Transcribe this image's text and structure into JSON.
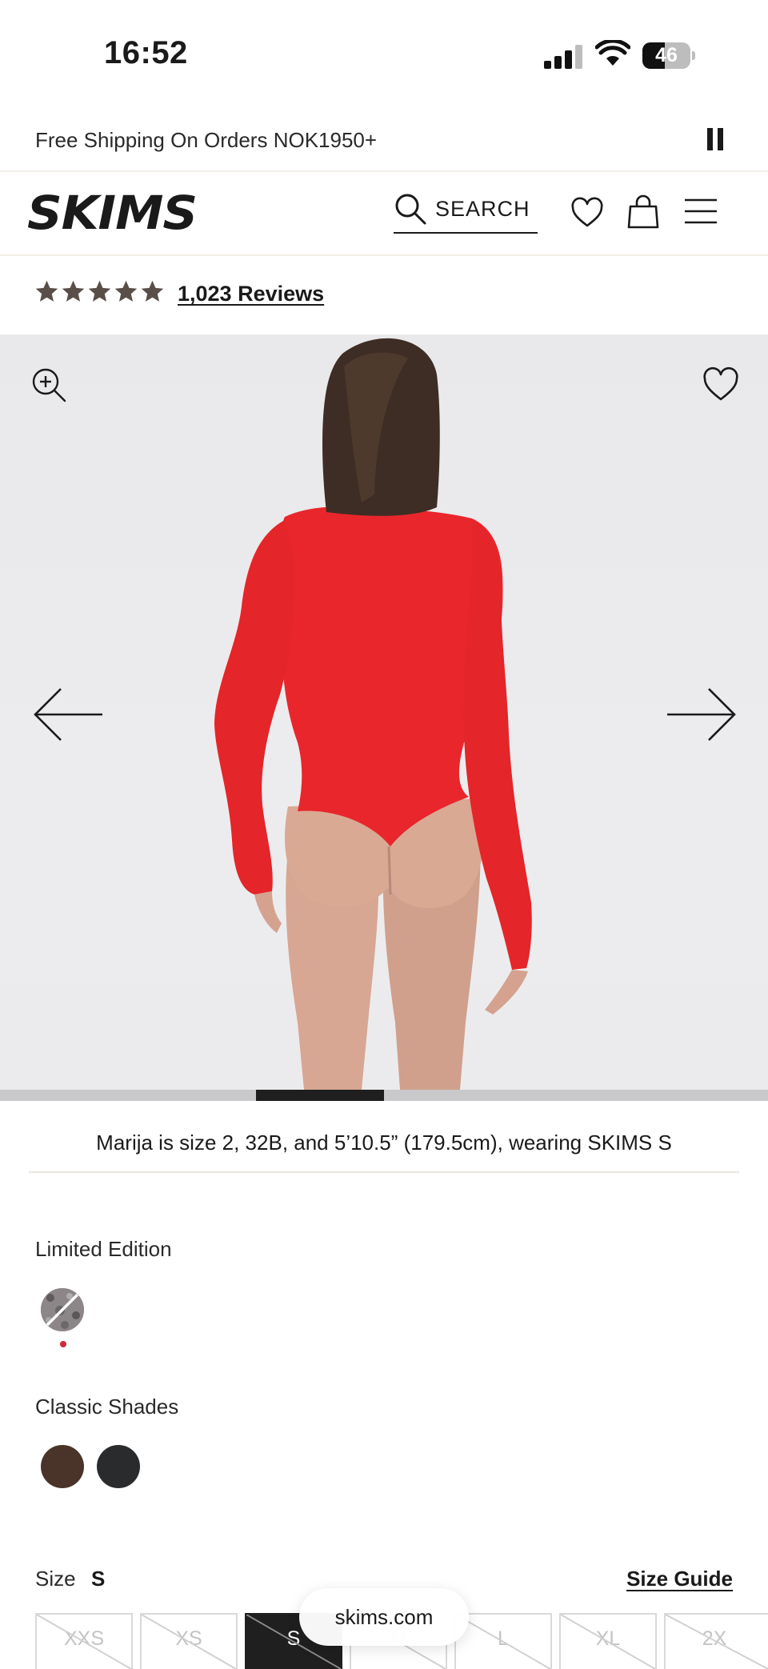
{
  "status_bar": {
    "time": "16:52",
    "battery": "46",
    "battery_level": 0.46
  },
  "announcement": {
    "text": "Free Shipping On Orders NOK1950+"
  },
  "header": {
    "brand": "SKIMS",
    "search_label": "SEARCH"
  },
  "reviews": {
    "rating": 5,
    "count_label": "1,023 Reviews"
  },
  "gallery": {
    "progress_start": 0.333,
    "progress_end": 0.5
  },
  "model_info": "Marija is size 2, 32B, and 5’10.5” (179.5cm), wearing SKIMS S",
  "limited_edition": {
    "label": "Limited Edition",
    "swatches": [
      {
        "name": "snake print",
        "color": "#7a7476",
        "selected": true
      }
    ]
  },
  "classic_shades": {
    "label": "Classic Shades",
    "swatches": [
      {
        "name": "cocoa",
        "color": "#4a3328"
      },
      {
        "name": "onyx",
        "color": "#2a2b2d"
      }
    ]
  },
  "size": {
    "label": "Size",
    "selected": "S",
    "guide_label": "Size Guide",
    "options": [
      {
        "label": "XXS",
        "available": false
      },
      {
        "label": "XS",
        "available": false
      },
      {
        "label": "S",
        "available": false,
        "selected": true
      },
      {
        "label": "M",
        "available": false
      },
      {
        "label": "L",
        "available": false
      },
      {
        "label": "XL",
        "available": false
      },
      {
        "label": "2X",
        "available": false
      }
    ]
  },
  "browser": {
    "url": "skims.com"
  },
  "colors": {
    "accent_dot": "#d0283a",
    "bodysuit": "#e8262c",
    "star": "#5a4e49"
  },
  "icons": {
    "signal": "cellular-signal-icon",
    "wifi": "wifi-icon",
    "battery": "battery-icon",
    "pause": "pause-icon",
    "search": "search-icon",
    "wishlist": "heart-icon",
    "bag": "shopping-bag-icon",
    "menu": "hamburger-menu-icon",
    "zoom": "zoom-in-icon",
    "prev": "arrow-left-icon",
    "next": "arrow-right-icon"
  }
}
